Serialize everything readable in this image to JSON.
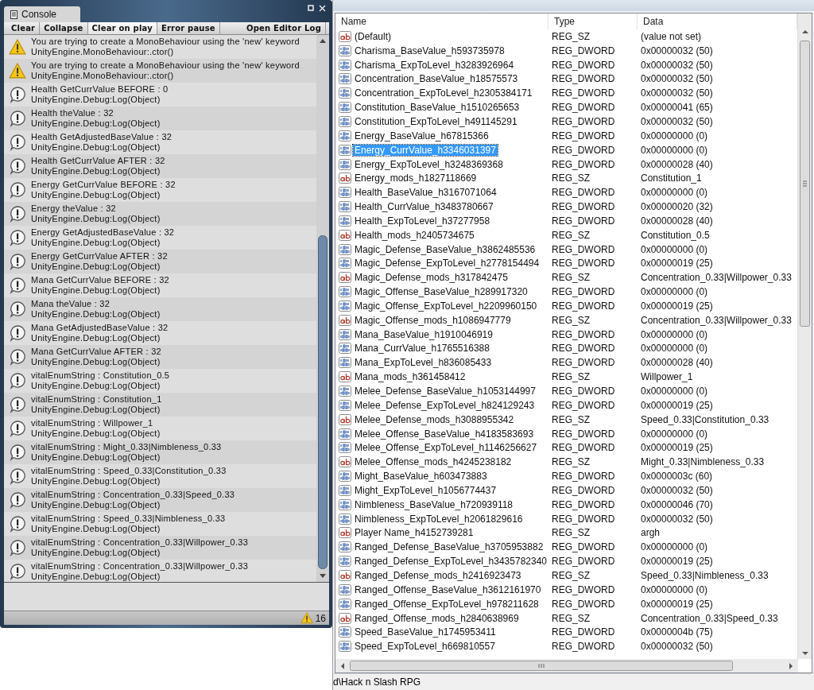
{
  "console": {
    "tab": {
      "label": "Console",
      "selected": true
    },
    "toolbar": [
      {
        "label": "Clear",
        "selected": false
      },
      {
        "label": "Collapse",
        "selected": false
      },
      {
        "label": "Clear on play",
        "selected": true
      },
      {
        "label": "Error pause",
        "selected": false
      },
      {
        "label": "Open Editor Log",
        "selected": false
      }
    ],
    "entries": [
      {
        "kind": "warning",
        "message": "You are trying to create a MonoBehaviour using the 'new' keyword",
        "trace": "UnityEngine.MonoBehaviour:.ctor()"
      },
      {
        "kind": "warning",
        "message": "You are trying to create a MonoBehaviour using the 'new' keyword",
        "trace": "UnityEngine.MonoBehaviour:.ctor()"
      },
      {
        "kind": "log",
        "message": "Health GetCurrValue BEFORE  : 0",
        "trace": "UnityEngine.Debug:Log(Object)"
      },
      {
        "kind": "log",
        "message": "Health theValue : 32",
        "trace": "UnityEngine.Debug:Log(Object)"
      },
      {
        "kind": "log",
        "message": "Health GetAdjustedBaseValue : 32",
        "trace": "UnityEngine.Debug:Log(Object)"
      },
      {
        "kind": "log",
        "message": "Health GetCurrValue AFTER   : 32",
        "trace": "UnityEngine.Debug:Log(Object)"
      },
      {
        "kind": "log",
        "message": "Energy GetCurrValue BEFORE  : 32",
        "trace": "UnityEngine.Debug:Log(Object)"
      },
      {
        "kind": "log",
        "message": "Energy theValue : 32",
        "trace": "UnityEngine.Debug:Log(Object)"
      },
      {
        "kind": "log",
        "message": "Energy GetAdjustedBaseValue : 32",
        "trace": "UnityEngine.Debug:Log(Object)"
      },
      {
        "kind": "log",
        "message": "Energy GetCurrValue AFTER   : 32",
        "trace": "UnityEngine.Debug:Log(Object)"
      },
      {
        "kind": "log",
        "message": "Mana GetCurrValue BEFORE  : 32",
        "trace": "UnityEngine.Debug:Log(Object)"
      },
      {
        "kind": "log",
        "message": "Mana theValue : 32",
        "trace": "UnityEngine.Debug:Log(Object)"
      },
      {
        "kind": "log",
        "message": "Mana GetAdjustedBaseValue : 32",
        "trace": "UnityEngine.Debug:Log(Object)"
      },
      {
        "kind": "log",
        "message": "Mana GetCurrValue AFTER   : 32",
        "trace": "UnityEngine.Debug:Log(Object)"
      },
      {
        "kind": "log",
        "message": "vitalEnumString : Constitution_0.5",
        "trace": "UnityEngine.Debug:Log(Object)"
      },
      {
        "kind": "log",
        "message": "vitalEnumString : Constitution_1",
        "trace": "UnityEngine.Debug:Log(Object)"
      },
      {
        "kind": "log",
        "message": "vitalEnumString : Willpower_1",
        "trace": "UnityEngine.Debug:Log(Object)"
      },
      {
        "kind": "log",
        "message": "vitalEnumString : Might_0.33|Nimbleness_0.33",
        "trace": "UnityEngine.Debug:Log(Object)"
      },
      {
        "kind": "log",
        "message": "vitalEnumString : Speed_0.33|Constitution_0.33",
        "trace": "UnityEngine.Debug:Log(Object)"
      },
      {
        "kind": "log",
        "message": "vitalEnumString : Concentration_0.33|Speed_0.33",
        "trace": "UnityEngine.Debug:Log(Object)"
      },
      {
        "kind": "log",
        "message": "vitalEnumString : Speed_0.33|Nimbleness_0.33",
        "trace": "UnityEngine.Debug:Log(Object)"
      },
      {
        "kind": "log",
        "message": "vitalEnumString : Concentration_0.33|Willpower_0.33",
        "trace": "UnityEngine.Debug:Log(Object)"
      },
      {
        "kind": "log",
        "message": "vitalEnumString : Concentration_0.33|Willpower_0.33",
        "trace": "UnityEngine.Debug:Log(Object)"
      }
    ],
    "warning_count": "16"
  },
  "registry": {
    "columns": [
      "Name",
      "Type",
      "Data"
    ],
    "rows": [
      {
        "kind": "sz",
        "name": "(Default)",
        "type": "REG_SZ",
        "data": "(value not set)",
        "selected": false
      },
      {
        "kind": "dword",
        "name": "Charisma_BaseValue_h593735978",
        "type": "REG_DWORD",
        "data": "0x00000032 (50)",
        "selected": false
      },
      {
        "kind": "dword",
        "name": "Charisma_ExpToLevel_h3283926964",
        "type": "REG_DWORD",
        "data": "0x00000032 (50)",
        "selected": false
      },
      {
        "kind": "dword",
        "name": "Concentration_BaseValue_h18575573",
        "type": "REG_DWORD",
        "data": "0x00000032 (50)",
        "selected": false
      },
      {
        "kind": "dword",
        "name": "Concentration_ExpToLevel_h2305384171",
        "type": "REG_DWORD",
        "data": "0x00000032 (50)",
        "selected": false
      },
      {
        "kind": "dword",
        "name": "Constitution_BaseValue_h1510265653",
        "type": "REG_DWORD",
        "data": "0x00000041 (65)",
        "selected": false
      },
      {
        "kind": "dword",
        "name": "Constitution_ExpToLevel_h491145291",
        "type": "REG_DWORD",
        "data": "0x00000032 (50)",
        "selected": false
      },
      {
        "kind": "dword",
        "name": "Energy_BaseValue_h67815366",
        "type": "REG_DWORD",
        "data": "0x00000000 (0)",
        "selected": false
      },
      {
        "kind": "dword",
        "name": "Energy_CurrValue_h3346031397",
        "type": "REG_DWORD",
        "data": "0x00000000 (0)",
        "selected": true
      },
      {
        "kind": "dword",
        "name": "Energy_ExpToLevel_h3248369368",
        "type": "REG_DWORD",
        "data": "0x00000028 (40)",
        "selected": false
      },
      {
        "kind": "sz",
        "name": "Energy_mods_h1827118669",
        "type": "REG_SZ",
        "data": "Constitution_1",
        "selected": false
      },
      {
        "kind": "dword",
        "name": "Health_BaseValue_h3167071064",
        "type": "REG_DWORD",
        "data": "0x00000000 (0)",
        "selected": false
      },
      {
        "kind": "dword",
        "name": "Health_CurrValue_h3483780667",
        "type": "REG_DWORD",
        "data": "0x00000020 (32)",
        "selected": false
      },
      {
        "kind": "dword",
        "name": "Health_ExpToLevel_h37277958",
        "type": "REG_DWORD",
        "data": "0x00000028 (40)",
        "selected": false
      },
      {
        "kind": "sz",
        "name": "Health_mods_h2405734675",
        "type": "REG_SZ",
        "data": "Constitution_0.5",
        "selected": false
      },
      {
        "kind": "dword",
        "name": "Magic_Defense_BaseValue_h3862485536",
        "type": "REG_DWORD",
        "data": "0x00000000 (0)",
        "selected": false
      },
      {
        "kind": "dword",
        "name": "Magic_Defense_ExpToLevel_h2778154494",
        "type": "REG_DWORD",
        "data": "0x00000019 (25)",
        "selected": false
      },
      {
        "kind": "sz",
        "name": "Magic_Defense_mods_h317842475",
        "type": "REG_SZ",
        "data": "Concentration_0.33|Willpower_0.33",
        "selected": false
      },
      {
        "kind": "dword",
        "name": "Magic_Offense_BaseValue_h289917320",
        "type": "REG_DWORD",
        "data": "0x00000000 (0)",
        "selected": false
      },
      {
        "kind": "dword",
        "name": "Magic_Offense_ExpToLevel_h2209960150",
        "type": "REG_DWORD",
        "data": "0x00000019 (25)",
        "selected": false
      },
      {
        "kind": "sz",
        "name": "Magic_Offense_mods_h1086947779",
        "type": "REG_SZ",
        "data": "Concentration_0.33|Willpower_0.33",
        "selected": false
      },
      {
        "kind": "dword",
        "name": "Mana_BaseValue_h1910046919",
        "type": "REG_DWORD",
        "data": "0x00000000 (0)",
        "selected": false
      },
      {
        "kind": "dword",
        "name": "Mana_CurrValue_h1765516388",
        "type": "REG_DWORD",
        "data": "0x00000000 (0)",
        "selected": false
      },
      {
        "kind": "dword",
        "name": "Mana_ExpToLevel_h836085433",
        "type": "REG_DWORD",
        "data": "0x00000028 (40)",
        "selected": false
      },
      {
        "kind": "sz",
        "name": "Mana_mods_h361458412",
        "type": "REG_SZ",
        "data": "Willpower_1",
        "selected": false
      },
      {
        "kind": "dword",
        "name": "Melee_Defense_BaseValue_h1053144997",
        "type": "REG_DWORD",
        "data": "0x00000000 (0)",
        "selected": false
      },
      {
        "kind": "dword",
        "name": "Melee_Defense_ExpToLevel_h824129243",
        "type": "REG_DWORD",
        "data": "0x00000019 (25)",
        "selected": false
      },
      {
        "kind": "sz",
        "name": "Melee_Defense_mods_h3088955342",
        "type": "REG_SZ",
        "data": "Speed_0.33|Constitution_0.33",
        "selected": false
      },
      {
        "kind": "dword",
        "name": "Melee_Offense_BaseValue_h4183583693",
        "type": "REG_DWORD",
        "data": "0x00000000 (0)",
        "selected": false
      },
      {
        "kind": "dword",
        "name": "Melee_Offense_ExpToLevel_h1146256627",
        "type": "REG_DWORD",
        "data": "0x00000019 (25)",
        "selected": false
      },
      {
        "kind": "sz",
        "name": "Melee_Offense_mods_h4245238182",
        "type": "REG_SZ",
        "data": "Might_0.33|Nimbleness_0.33",
        "selected": false
      },
      {
        "kind": "dword",
        "name": "Might_BaseValue_h603473883",
        "type": "REG_DWORD",
        "data": "0x0000003c (60)",
        "selected": false
      },
      {
        "kind": "dword",
        "name": "Might_ExpToLevel_h1056774437",
        "type": "REG_DWORD",
        "data": "0x00000032 (50)",
        "selected": false
      },
      {
        "kind": "dword",
        "name": "Nimbleness_BaseValue_h720939118",
        "type": "REG_DWORD",
        "data": "0x00000046 (70)",
        "selected": false
      },
      {
        "kind": "dword",
        "name": "Nimbleness_ExpToLevel_h2061829616",
        "type": "REG_DWORD",
        "data": "0x00000032 (50)",
        "selected": false
      },
      {
        "kind": "sz",
        "name": "Player Name_h4152739281",
        "type": "REG_SZ",
        "data": "argh",
        "selected": false
      },
      {
        "kind": "dword",
        "name": "Ranged_Defense_BaseValue_h3705953882",
        "type": "REG_DWORD",
        "data": "0x00000000 (0)",
        "selected": false
      },
      {
        "kind": "dword",
        "name": "Ranged_Defense_ExpToLevel_h3435782340",
        "type": "REG_DWORD",
        "data": "0x00000019 (25)",
        "selected": false
      },
      {
        "kind": "sz",
        "name": "Ranged_Defense_mods_h2416923473",
        "type": "REG_SZ",
        "data": "Speed_0.33|Nimbleness_0.33",
        "selected": false
      },
      {
        "kind": "dword",
        "name": "Ranged_Offense_BaseValue_h3612161970",
        "type": "REG_DWORD",
        "data": "0x00000000 (0)",
        "selected": false
      },
      {
        "kind": "dword",
        "name": "Ranged_Offense_ExpToLevel_h978211628",
        "type": "REG_DWORD",
        "data": "0x00000019 (25)",
        "selected": false
      },
      {
        "kind": "sz",
        "name": "Ranged_Offense_mods_h2840638969",
        "type": "REG_SZ",
        "data": "Concentration_0.33|Speed_0.33",
        "selected": false
      },
      {
        "kind": "dword",
        "name": "Speed_BaseValue_h1745953411",
        "type": "REG_DWORD",
        "data": "0x0000004b (75)",
        "selected": false
      },
      {
        "kind": "dword",
        "name": "Speed_ExpToLevel_h669810557",
        "type": "REG_DWORD",
        "data": "0x00000032 (50)",
        "selected": false
      }
    ],
    "status_bar": "d\\Hack n Slash RPG"
  }
}
